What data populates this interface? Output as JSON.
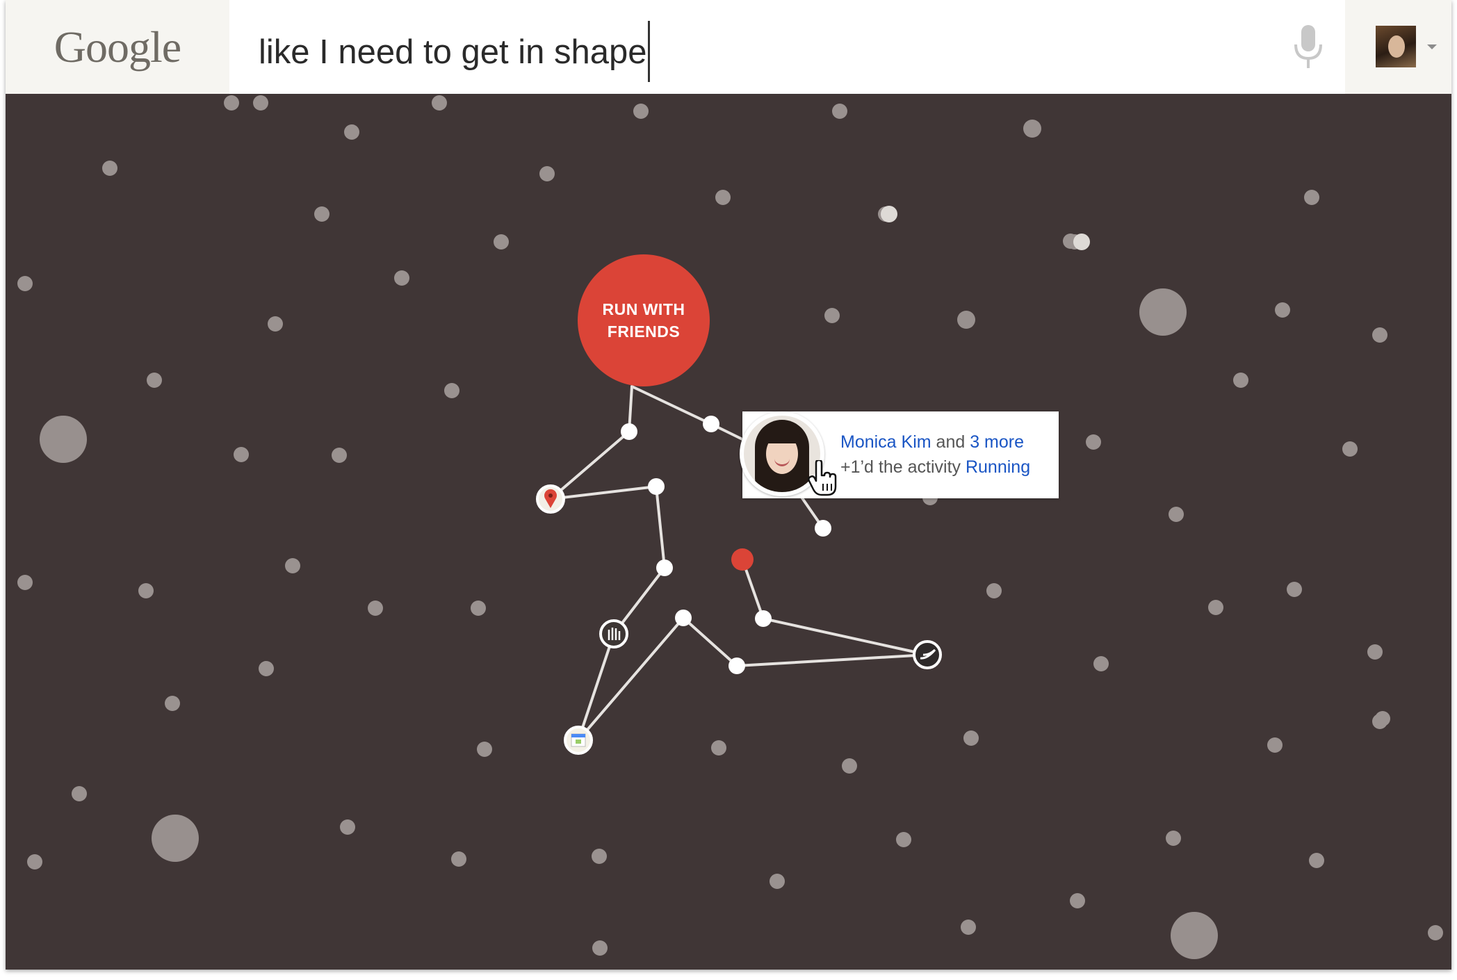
{
  "header": {
    "logo_text": "Google",
    "search_query": "like I need to get in shape",
    "mic_icon": "microphone-icon",
    "account_icon": "profile-avatar",
    "account_menu_icon": "dropdown-caret-icon"
  },
  "node_main": {
    "label": "RUN WITH FRIENDS",
    "color": "#db4437"
  },
  "popup": {
    "person_name": "Monica Kim",
    "connector": " and ",
    "more_link": "3 more",
    "action_text": "+1’d the activity ",
    "activity_link": "Running",
    "link_color": "#1a55c4"
  },
  "app_icons": [
    "maps-pin-icon",
    "fitness-app-icon",
    "calendar-icon",
    "nike-app-icon"
  ],
  "colors": {
    "background": "#403636",
    "accent_red": "#db4437",
    "dots": "#9a9290",
    "lines": "#e6e3e0"
  }
}
